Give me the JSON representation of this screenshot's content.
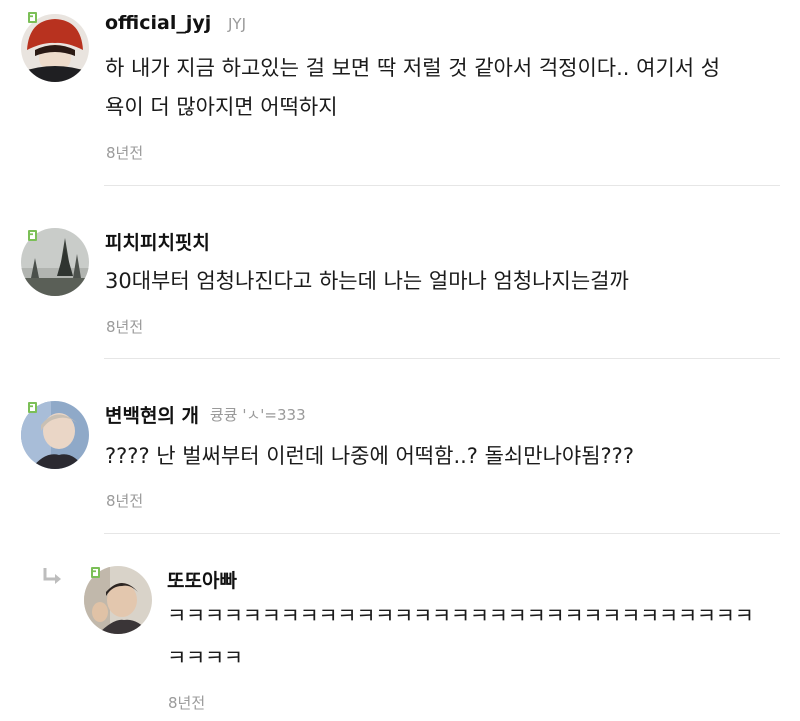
{
  "comments": [
    {
      "nickname": "official_jyj",
      "sub": "JYJ",
      "lines": [
        "하 내가 지금 하고있는 걸 보면 딱 저럴 것 같아서 걱정이다.. 여기서 성",
        "욕이 더 많아지면 어떡하지"
      ],
      "time": "8년전"
    },
    {
      "nickname": "피치피치핏치",
      "sub": "",
      "lines": [
        "30대부터 엄청나진다고 하는데 나는 얼마나 엄청나지는걸까"
      ],
      "time": "8년전"
    },
    {
      "nickname": "변백현의 개",
      "sub": "큥큥 'ㅅ'=333",
      "lines": [
        "???? 난 벌써부터 이런데 나중에 어떡함..? 돌쇠만나야됨???"
      ],
      "time": "8년전"
    }
  ],
  "reply": {
    "nickname": "또또아빠",
    "lines": [
      "ㅋㅋㅋㅋㅋㅋㅋㅋㅋㅋㅋㅋㅋㅋㅋㅋㅋㅋㅋㅋㅋㅋㅋㅋㅋㅋㅋㅋㅋㅋㅋ",
      "ㅋㅋㅋㅋ"
    ],
    "time": "8년전"
  },
  "icons": {
    "level_badge": "level-badge-icon",
    "reply_arrow": "reply-arrow-icon"
  }
}
